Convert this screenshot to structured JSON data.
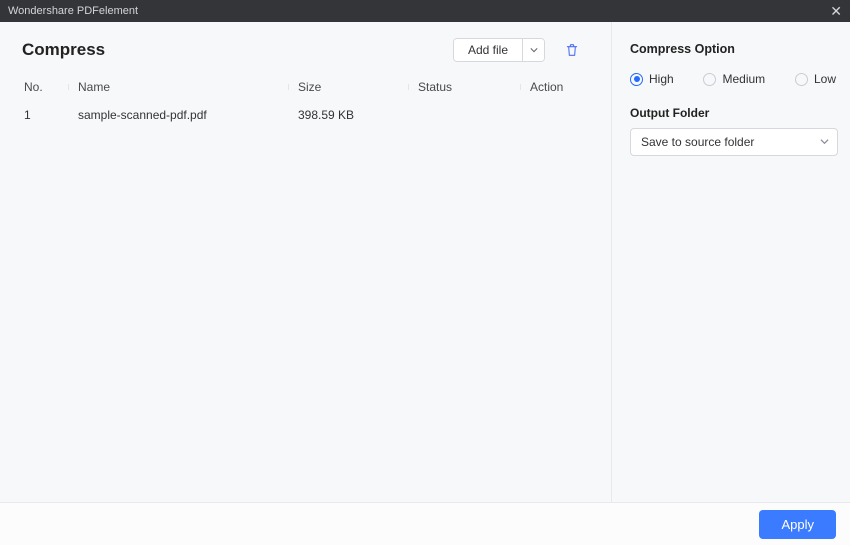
{
  "titlebar": {
    "title": "Wondershare PDFelement"
  },
  "main": {
    "heading": "Compress",
    "addfile_label": "Add file",
    "columns": {
      "no": "No.",
      "name": "Name",
      "size": "Size",
      "status": "Status",
      "action": "Action"
    },
    "rows": [
      {
        "no": "1",
        "name": "sample-scanned-pdf.pdf",
        "size": "398.59 KB",
        "status": "",
        "action": ""
      }
    ]
  },
  "options": {
    "heading": "Compress Option",
    "radios": {
      "high": "High",
      "medium": "Medium",
      "low": "Low",
      "selected": "high"
    },
    "output_heading": "Output Folder",
    "output_value": "Save to source folder"
  },
  "footer": {
    "apply_label": "Apply"
  }
}
